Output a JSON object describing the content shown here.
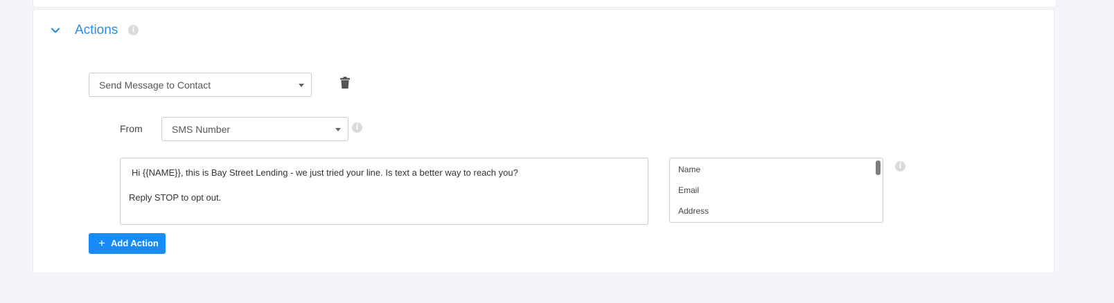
{
  "section": {
    "title": "Actions",
    "accent_color": "#2b8ae0"
  },
  "icons": {
    "collapse": "chevron-down-icon",
    "info": "info-icon",
    "delete": "trash-icon"
  },
  "action": {
    "type_selected": "Send Message to Contact"
  },
  "from": {
    "label": "From",
    "selected": "SMS Number"
  },
  "message": {
    "line1": "Hi {{NAME}}, this is Bay Street Lending - we just tried your line. Is text a better way to reach you?",
    "line2": "Reply STOP to opt out."
  },
  "merge_fields": [
    "Name",
    "Email",
    "Address"
  ],
  "add_action": {
    "label": "Add Action",
    "color": "#188bf6"
  }
}
